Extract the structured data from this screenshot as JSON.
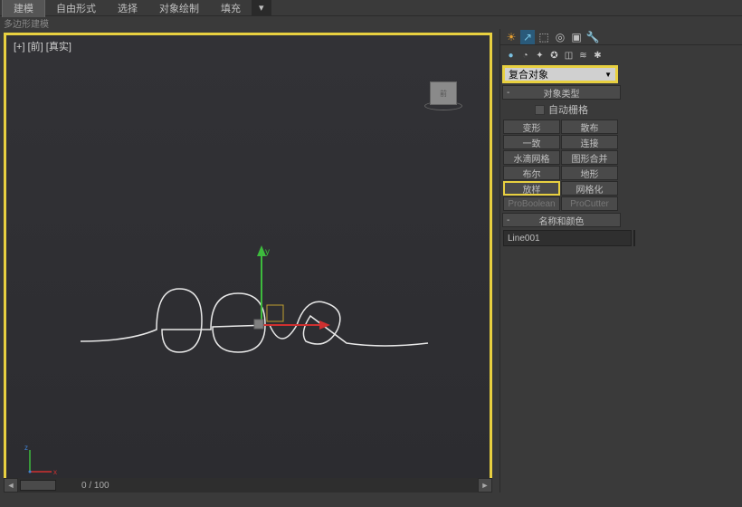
{
  "top_tabs": {
    "modeling": "建模",
    "freeform": "自由形式",
    "selection": "选择",
    "obj_paint": "对象绘制",
    "populate": "填充"
  },
  "ribbon_label": "多边形建模",
  "viewport": {
    "label": "[+] [前] [真实]",
    "viewcube_face": "前"
  },
  "scrollbar": {
    "text": "0 / 100"
  },
  "command_panel": {
    "dropdown_value": "复合对象",
    "rollout_object_type": "对象类型",
    "auto_grid_label": "自动栅格",
    "buttons": {
      "morph": "变形",
      "scatter": "散布",
      "conform": "一致",
      "connect": "连接",
      "blobmesh": "水滴网格",
      "shapemerge": "图形合并",
      "boolean": "布尔",
      "terrain": "地形",
      "loft": "放样",
      "mesher": "网格化",
      "proboolean": "ProBoolean",
      "procutter": "ProCutter"
    },
    "rollout_name_color": "名称和颜色",
    "object_name": "Line001"
  }
}
